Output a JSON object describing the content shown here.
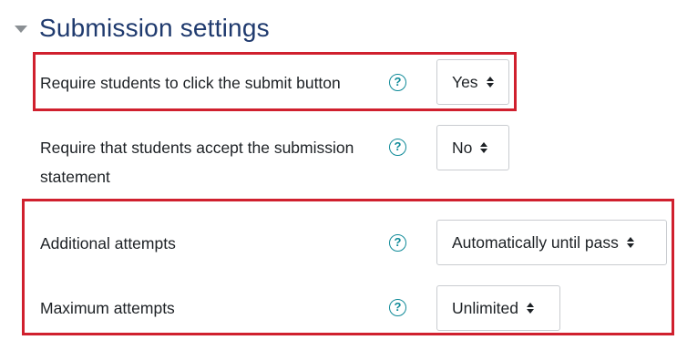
{
  "section": {
    "title": "Submission settings"
  },
  "settings": [
    {
      "label": "Require students to click the submit button",
      "value": "Yes"
    },
    {
      "label_line1": "Require that students accept the submission",
      "label_line2": "statement",
      "value": "No"
    },
    {
      "label": "Additional attempts",
      "value": "Automatically until pass"
    },
    {
      "label": "Maximum attempts",
      "value": "Unlimited"
    }
  ],
  "help_glyph": "?",
  "colors": {
    "title": "#1f3a6e",
    "help_icon": "#0f8a98",
    "highlight": "#d0202e",
    "select_border": "#c9ccd0"
  },
  "icons": {
    "section_toggle": "caret-down-icon",
    "help": "question-circle-icon",
    "select_arrows": "sort-arrows-icon"
  }
}
